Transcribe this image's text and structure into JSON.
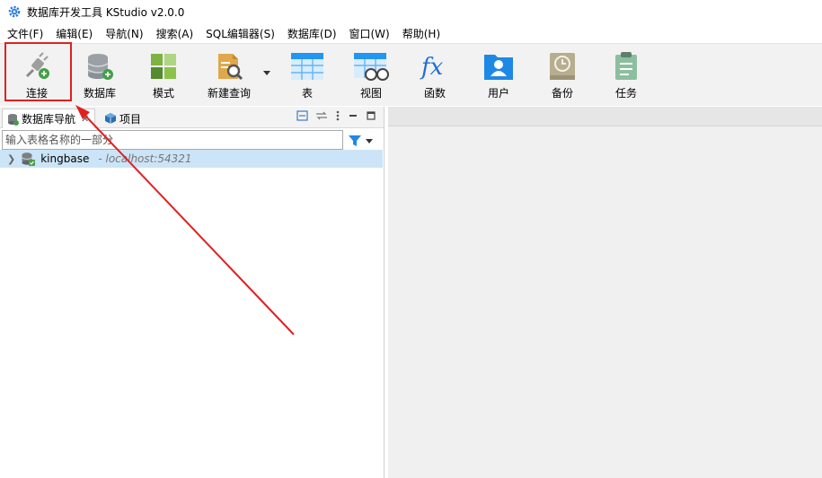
{
  "window": {
    "title": "数据库开发工具 KStudio v2.0.0",
    "icon": "gear-app-icon"
  },
  "menu": [
    "文件(F)",
    "编辑(E)",
    "导航(N)",
    "搜索(A)",
    "SQL编辑器(S)",
    "数据库(D)",
    "窗口(W)",
    "帮助(H)"
  ],
  "toolbar": {
    "connect": "连接",
    "database": "数据库",
    "schema": "模式",
    "new_query": "新建查询",
    "table": "表",
    "view": "视图",
    "function": "函数",
    "user": "用户",
    "backup": "备份",
    "task": "任务",
    "fx_glyph": "fx"
  },
  "navigator": {
    "tab_db": "数据库导航",
    "tab_project": "项目",
    "filter_placeholder": "输入表格名称的一部分",
    "connections": [
      {
        "name": "kingbase",
        "host": "- localhost:54321"
      }
    ]
  },
  "colors": {
    "highlight": "#e02020",
    "selection": "#cce4f7",
    "accent_blue": "#1e88e5",
    "accent_green": "#43a047"
  }
}
